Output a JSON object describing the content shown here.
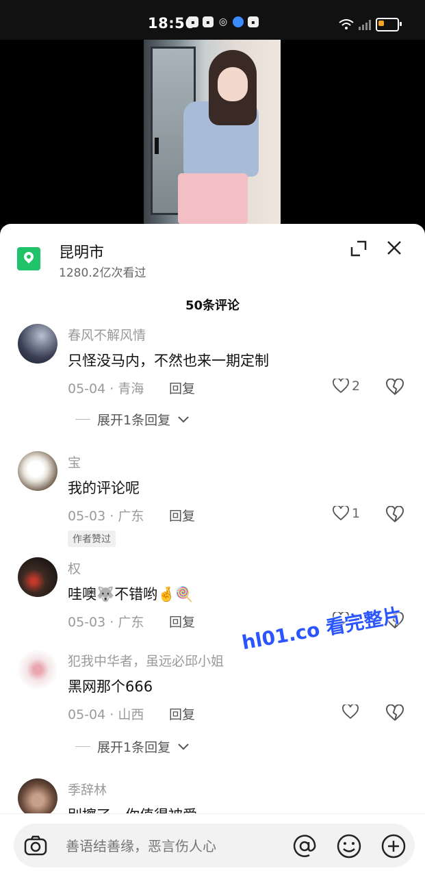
{
  "status_bar": {
    "time": "18:56"
  },
  "header": {
    "location_title": "昆明市",
    "views": "1280.2亿次看过",
    "comment_count": "50条评论"
  },
  "comments": [
    {
      "user": "春风不解风情",
      "text": "只怪没马内，不然也来一期定制",
      "meta": "05-04 · 青海",
      "reply": "回复",
      "likes": "2",
      "expand": "展开1条回复"
    },
    {
      "user": "宝",
      "text": "我的评论呢",
      "meta": "05-03 · 广东",
      "reply": "回复",
      "likes": "1",
      "badge": "作者赞过"
    },
    {
      "user": "权",
      "text": "哇噢🐺不错哟🤞🍭",
      "meta": "05-03 · 广东",
      "reply": "回复",
      "likes": "1"
    },
    {
      "user": "犯我中华者，虽远必邱小姐",
      "text": "黑网那个666",
      "meta": "05-04 · 山西",
      "reply": "回复",
      "likes": "",
      "expand": "展开1条回复"
    },
    {
      "user": "季辞林",
      "text": "别擦了，你值得被爱"
    }
  ],
  "watermark": "hl01.co 看完整片",
  "input": {
    "placeholder": "善语结善缘，恶言伤人心"
  }
}
